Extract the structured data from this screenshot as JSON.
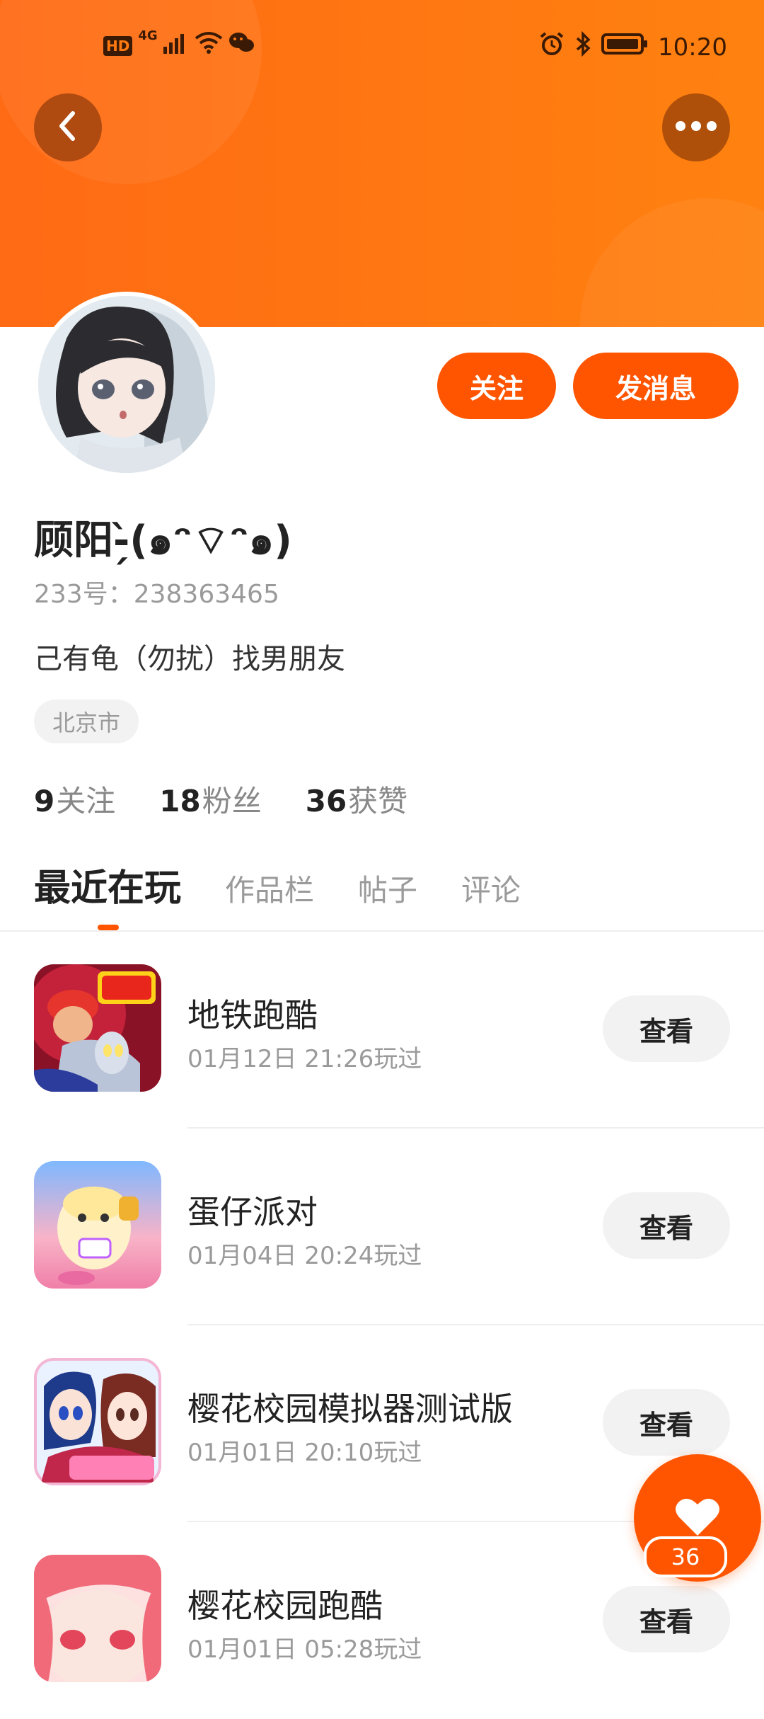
{
  "status_bar": {
    "network_badge": "HD",
    "network_type": "4G",
    "time": "10:20",
    "icons": [
      "signal-icon",
      "wifi-icon",
      "wechat-icon",
      "alarm-icon",
      "bluetooth-icon",
      "battery-icon"
    ]
  },
  "header": {
    "colors": {
      "gradient_start": "#ff6a14",
      "gradient_end": "#ff8210"
    },
    "back_icon": "chevron-left-icon",
    "more_icon": "more-horizontal-icon"
  },
  "profile": {
    "username": "顾阳-̗̀(๑ᵔ⌔ᵔ๑)",
    "uid": "233号：238363465",
    "bio": "己有龟（勿扰）找男朋友",
    "location": "北京市",
    "follow_label": "关注",
    "message_label": "发消息",
    "accent_color": "#ff5500"
  },
  "stats": [
    {
      "num": "9",
      "label": "关注"
    },
    {
      "num": "18",
      "label": "粉丝"
    },
    {
      "num": "36",
      "label": "获赞"
    }
  ],
  "tabs": [
    {
      "label": "最近在玩",
      "active": true
    },
    {
      "label": "作品栏",
      "active": false
    },
    {
      "label": "帖子",
      "active": false
    },
    {
      "label": "评论",
      "active": false
    }
  ],
  "games": [
    {
      "name": "地铁跑酷",
      "time": "01月12日 21:26玩过",
      "view_label": "查看"
    },
    {
      "name": "蛋仔派对",
      "time": "01月04日 20:24玩过",
      "view_label": "查看"
    },
    {
      "name": "樱花校园模拟器测试版",
      "time": "01月01日 20:10玩过",
      "view_label": "查看"
    },
    {
      "name": "樱花校园跑酷",
      "time": "01月01日 05:28玩过",
      "view_label": "查看"
    }
  ],
  "like_fab": {
    "icon": "heart-icon",
    "count": "36"
  }
}
